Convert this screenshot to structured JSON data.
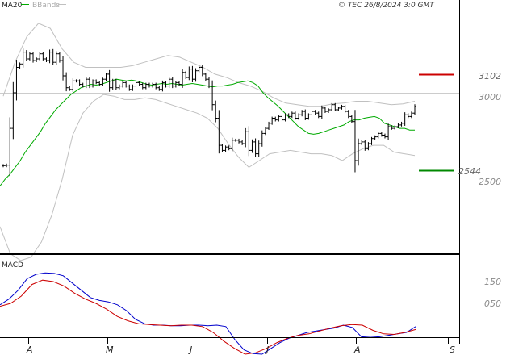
{
  "header": {
    "ma_label": "MA20",
    "bands_label": "BBands",
    "copyright": "© TEC 26/8/2024 3:0 GMT"
  },
  "macd": {
    "label": "MACD"
  },
  "colors": {
    "price": "#000000",
    "ma": "#00aa00",
    "bands": "#c0c0c0",
    "resistance": "#cc0000",
    "support": "#008800",
    "macd_line": "#0000cc",
    "signal_line": "#cc0000",
    "grid": "#cccccc",
    "frame": "#000000"
  },
  "chart_data": [
    {
      "type": "ohlc",
      "title": "",
      "x_tick_labels": [
        "A",
        "M",
        "J",
        "J",
        "A",
        "S"
      ],
      "y_tick_labels": [
        "3000",
        "2500"
      ],
      "ylim": [
        2000,
        3420
      ],
      "grid": true,
      "levels": [
        {
          "name": "resistance",
          "label": "3102",
          "value": 3102
        },
        {
          "name": "support",
          "label": "2544",
          "value": 2544
        }
      ],
      "series": [
        {
          "name": "price",
          "values": [
            2570,
            2573,
            2790,
            3000,
            3150,
            3170,
            3240,
            3200,
            3230,
            3190,
            3200,
            3230,
            3200,
            3190,
            3240,
            3180,
            3230,
            3190,
            3100,
            3030,
            3020,
            3070,
            3070,
            3050,
            3040,
            3080,
            3040,
            3070,
            3060,
            3050,
            3080,
            3110,
            3030,
            3070,
            3030,
            3040,
            3060,
            3040,
            3020,
            3040,
            3060,
            3050,
            3030,
            3050,
            3040,
            3050,
            3030,
            3020,
            3060,
            3040,
            3080,
            3040,
            3060,
            3050,
            3120,
            3090,
            3140,
            3080,
            3130,
            3150,
            3110,
            3080,
            3040,
            2930,
            2850,
            2690,
            2660,
            2680,
            2670,
            2720,
            2720,
            2710,
            2700,
            2770,
            2660,
            2710,
            2640,
            2700,
            2760,
            2790,
            2820,
            2850,
            2840,
            2860,
            2840,
            2870,
            2860,
            2880,
            2850,
            2870,
            2890,
            2850,
            2870,
            2890,
            2880,
            2860,
            2910,
            2890,
            2900,
            2930,
            2900,
            2910,
            2920,
            2890,
            2860,
            2830,
            2600,
            2700,
            2710,
            2670,
            2700,
            2730,
            2740,
            2760,
            2750,
            2740,
            2800,
            2790,
            2800,
            2810,
            2820,
            2870,
            2860,
            2880,
            2920
          ]
        },
        {
          "name": "MA20",
          "values": [
            2450,
            2490,
            2520,
            2560,
            2600,
            2650,
            2690,
            2730,
            2770,
            2820,
            2860,
            2900,
            2930,
            2960,
            2990,
            3010,
            3030,
            3040,
            3050,
            3045,
            3050,
            3060,
            3070,
            3080,
            3075,
            3070,
            3075,
            3070,
            3060,
            3050,
            3045,
            3050,
            3055,
            3050,
            3055,
            3050,
            3045,
            3050,
            3055,
            3050,
            3045,
            3040,
            3035,
            3040,
            3040,
            3045,
            3050,
            3060,
            3065,
            3070,
            3060,
            3040,
            3000,
            2970,
            2945,
            2920,
            2890,
            2860,
            2830,
            2800,
            2780,
            2760,
            2755,
            2760,
            2770,
            2780,
            2790,
            2800,
            2810,
            2830,
            2840,
            2840,
            2850,
            2855,
            2860,
            2850,
            2820,
            2810,
            2800,
            2790,
            2790,
            2780,
            2780
          ]
        },
        {
          "name": "BBands upper",
          "values": [
            2980,
            3180,
            3330,
            3410,
            3380,
            3260,
            3180,
            3150,
            3150,
            3150,
            3150,
            3160,
            3180,
            3200,
            3220,
            3210,
            3180,
            3150,
            3110,
            3090,
            3060,
            3040,
            3010,
            2970,
            2940,
            2930,
            2920,
            2920,
            2935,
            2940,
            2950,
            2950,
            2940,
            2930,
            2935,
            2950
          ]
        },
        {
          "name": "BBands lower",
          "values": [
            2210,
            2050,
            2010,
            2030,
            2120,
            2280,
            2490,
            2750,
            2880,
            2950,
            2990,
            2980,
            2960,
            2960,
            2970,
            2960,
            2940,
            2920,
            2900,
            2880,
            2850,
            2790,
            2700,
            2620,
            2560,
            2600,
            2640,
            2650,
            2660,
            2650,
            2640,
            2640,
            2630,
            2600,
            2640,
            2670,
            2690,
            2690,
            2650,
            2640,
            2630
          ]
        }
      ]
    },
    {
      "type": "line",
      "title": "",
      "y_tick_labels": [
        "150",
        "050"
      ],
      "grid": true,
      "series": [
        {
          "name": "MACD",
          "values": [
            60,
            80,
            110,
            150,
            165,
            170,
            168,
            160,
            135,
            110,
            85,
            75,
            70,
            60,
            40,
            10,
            -5,
            -10,
            -10,
            -12,
            -12,
            -10,
            -10,
            -12,
            -10,
            -15,
            -60,
            -95,
            -108,
            -110,
            -90,
            -70,
            -55,
            -45,
            -35,
            -30,
            -25,
            -20,
            -10,
            -18,
            -50,
            -52,
            -50,
            -45,
            -40,
            -35,
            -15
          ]
        },
        {
          "name": "Signal",
          "values": [
            55,
            65,
            90,
            130,
            145,
            140,
            125,
            100,
            80,
            65,
            45,
            20,
            5,
            -5,
            -8,
            -10,
            -12,
            -10,
            -10,
            -15,
            -35,
            -65,
            -90,
            -110,
            -105,
            -90,
            -70,
            -55,
            -45,
            -40,
            -30,
            -20,
            -12,
            -8,
            -10,
            -28,
            -40,
            -42,
            -35,
            -25
          ]
        }
      ]
    }
  ]
}
